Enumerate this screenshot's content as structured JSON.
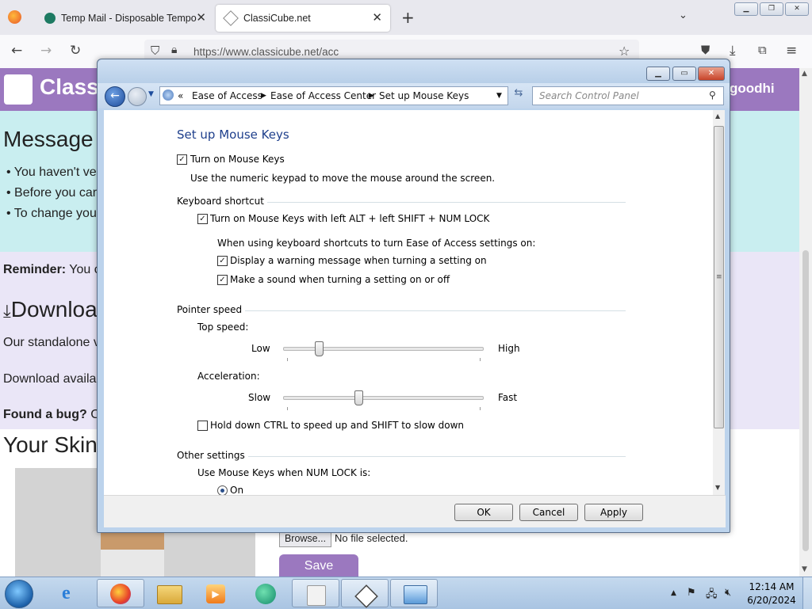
{
  "browser": {
    "tabs": [
      {
        "title": "Temp Mail - Disposable Tempo",
        "active": false
      },
      {
        "title": "ClassiCube.net",
        "active": true
      }
    ],
    "url": "https://www.classicube.net/acc"
  },
  "site": {
    "logo_text": "Class",
    "user_text": "goodhi",
    "message_heading": "Message",
    "bullets": [
      "You haven't ve",
      "Before you car",
      "To change you"
    ],
    "reminder_bold": "Reminder:",
    "reminder_text": "You c",
    "download_heading": "Downloa",
    "standalone_text": "Our standalone v",
    "download_available": "Download availa",
    "found_bug_bold": "Found a bug?",
    "found_bug_text": "C",
    "skin_heading": "Your Skin",
    "browse_label": "Browse...",
    "no_file_label": "No file selected.",
    "save_label": "Save"
  },
  "control_panel": {
    "breadcrumbs": [
      "Ease of Access",
      "Ease of Access Center",
      "Set up Mouse Keys"
    ],
    "search_placeholder": "Search Control Panel",
    "page_title": "Set up Mouse Keys",
    "turn_on_label": "Turn on Mouse Keys",
    "turn_on_checked": true,
    "turn_on_desc": "Use the numeric keypad to move the mouse around the screen.",
    "keyboard_shortcut_section": "Keyboard shortcut",
    "shortcut_label": "Turn on Mouse Keys with left ALT + left SHIFT + NUM LOCK",
    "shortcut_checked": true,
    "shortcut_note": "When using keyboard shortcuts to turn Ease of Access settings on:",
    "warning_label": "Display a warning message when turning a setting on",
    "warning_checked": true,
    "sound_label": "Make a sound when turning a setting on or off",
    "sound_checked": true,
    "pointer_speed_section": "Pointer speed",
    "top_speed_label": "Top speed:",
    "top_speed_low": "Low",
    "top_speed_high": "High",
    "top_speed_value": 0.18,
    "acceleration_label": "Acceleration:",
    "accel_low": "Slow",
    "accel_high": "Fast",
    "accel_value": 0.38,
    "ctrl_shift_label": "Hold down CTRL to speed up and SHIFT to slow down",
    "ctrl_shift_checked": false,
    "other_settings_section": "Other settings",
    "numlock_label": "Use Mouse Keys when NUM LOCK is:",
    "numlock_on_label": "On",
    "numlock_on_selected": true,
    "ok_label": "OK",
    "cancel_label": "Cancel",
    "apply_label": "Apply"
  },
  "taskbar": {
    "time": "12:14 AM",
    "date": "6/20/2024"
  },
  "colors": {
    "site_purple": "#9b78bf",
    "site_cyan": "#c9eef0",
    "cp_title_blue": "#1e3f8c"
  }
}
